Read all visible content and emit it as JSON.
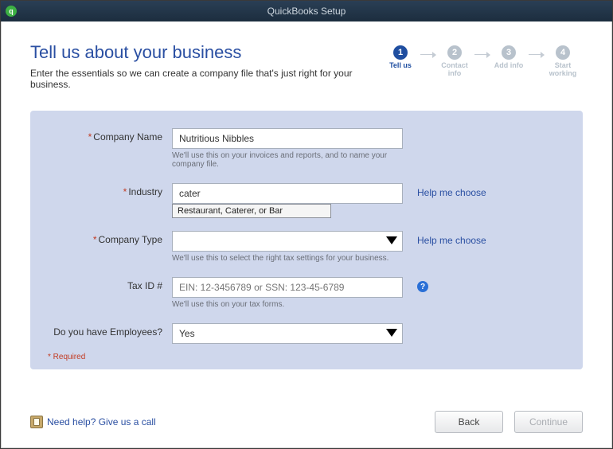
{
  "window": {
    "title": "QuickBooks Setup"
  },
  "header": {
    "heading": "Tell us about your business",
    "subtitle": "Enter the essentials so we can create a company file that's just right for your business."
  },
  "steps": [
    {
      "num": "1",
      "label": "Tell us",
      "active": true
    },
    {
      "num": "2",
      "label": "Contact info",
      "active": false
    },
    {
      "num": "3",
      "label": "Add info",
      "active": false
    },
    {
      "num": "4",
      "label": "Start working",
      "active": false
    }
  ],
  "form": {
    "company_name": {
      "label": "Company Name",
      "value": "Nutritious Nibbles",
      "hint": "We'll use this on your invoices and reports, and to name your company file."
    },
    "industry": {
      "label": "Industry",
      "value": "cater",
      "suggestion": "Restaurant, Caterer, or Bar",
      "help_link": "Help me choose"
    },
    "company_type": {
      "label": "Company Type",
      "value": "",
      "hint": "We'll use this to select the right tax settings for your business.",
      "help_link": "Help me choose"
    },
    "tax_id": {
      "label": "Tax ID #",
      "placeholder": "EIN: 12-3456789 or SSN: 123-45-6789",
      "hint": "We'll use this on your tax forms."
    },
    "employees": {
      "label": "Do you have Employees?",
      "value": "Yes"
    },
    "required_note": "* Required"
  },
  "footer": {
    "help": "Need help? Give us a call",
    "back": "Back",
    "continue": "Continue"
  }
}
